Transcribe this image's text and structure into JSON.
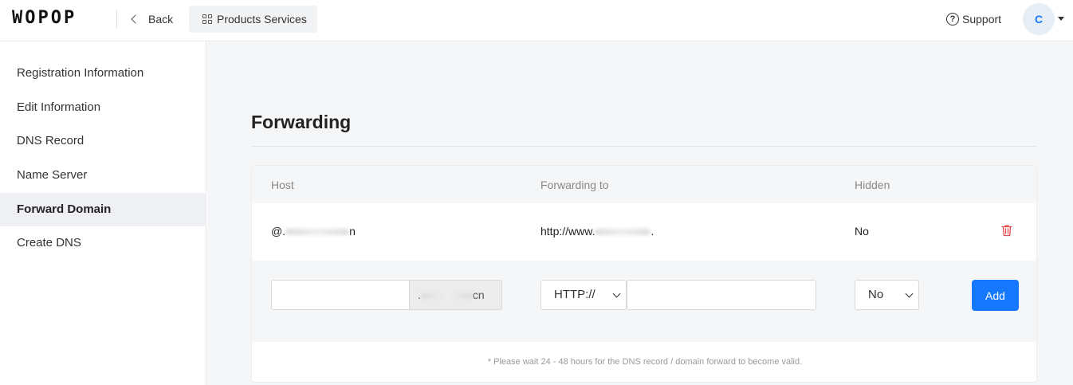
{
  "header": {
    "logo": "WOPOP",
    "back_label": "Back",
    "products_label": "Products Services",
    "support_label": "Support",
    "avatar_initial": "C",
    "accent_color": "#1677ff"
  },
  "sidebar": {
    "items": [
      {
        "label": "Registration Information",
        "active": false
      },
      {
        "label": "Edit Information",
        "active": false
      },
      {
        "label": "DNS Record",
        "active": false
      },
      {
        "label": "Name Server",
        "active": false
      },
      {
        "label": "Forward Domain",
        "active": true
      },
      {
        "label": "Create DNS",
        "active": false
      }
    ]
  },
  "main": {
    "title": "Forwarding",
    "table": {
      "columns": [
        "Host",
        "Forwarding to",
        "Hidden"
      ],
      "rows": [
        {
          "host_prefix": "@.",
          "host_suffix": "n",
          "forward_prefix": "http://www.",
          "forward_suffix": ".",
          "hidden": "No"
        }
      ]
    },
    "form": {
      "host_value": "",
      "host_suffix_prefix": ".",
      "host_suffix_end": "cn",
      "protocol": "HTTP://",
      "url_value": "",
      "hidden": "No",
      "add_label": "Add"
    },
    "note": "* Please wait 24 - 48 hours for the DNS record / domain forward to become valid."
  }
}
